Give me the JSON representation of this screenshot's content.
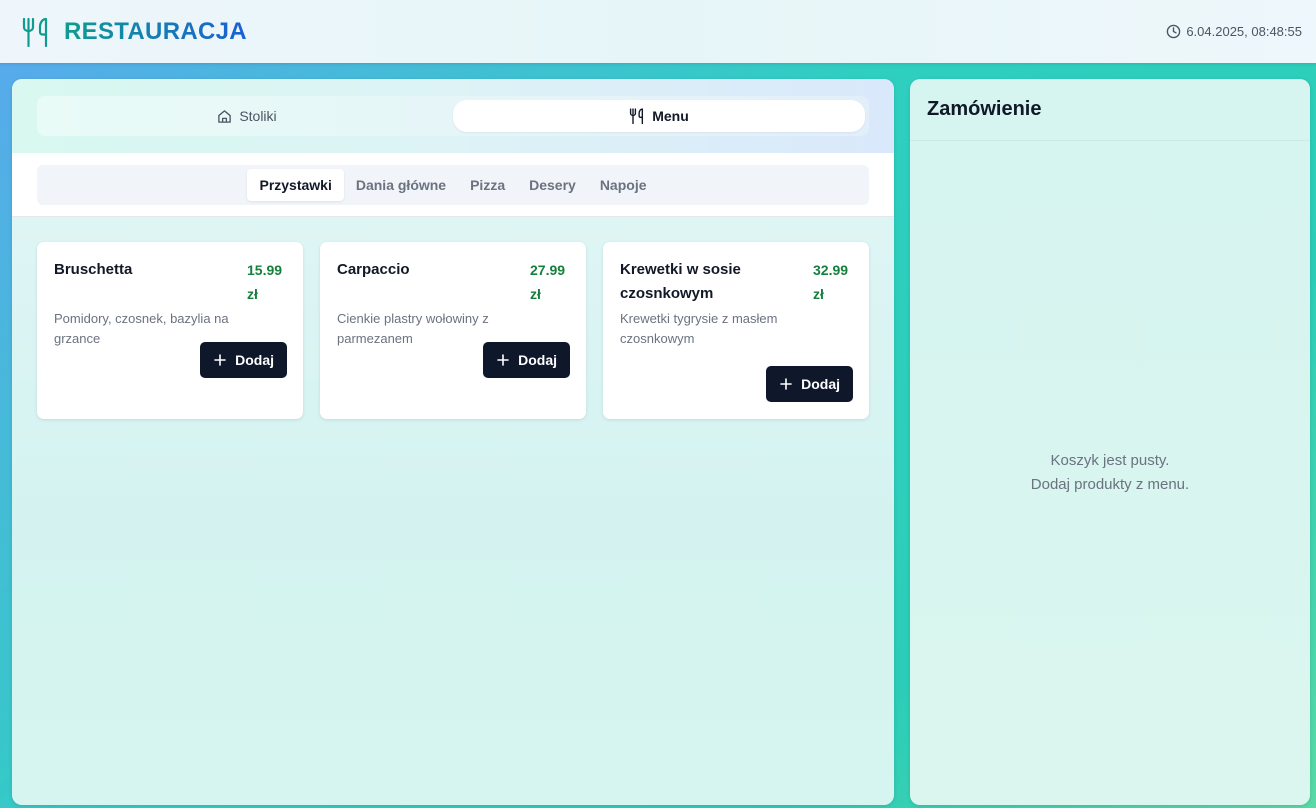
{
  "header": {
    "brand_title": "RESTAURACJA",
    "brand_icon": "utensils-icon",
    "datetime": "6.04.2025, 08:48:55",
    "clock_icon": "clock-icon"
  },
  "view_tabs": [
    {
      "label": "Stoliki",
      "icon": "home-icon",
      "active": false
    },
    {
      "label": "Menu",
      "icon": "utensils-icon",
      "active": true
    }
  ],
  "categories": [
    {
      "label": "Przystawki",
      "active": true
    },
    {
      "label": "Dania główne",
      "active": false
    },
    {
      "label": "Pizza",
      "active": false
    },
    {
      "label": "Desery",
      "active": false
    },
    {
      "label": "Napoje",
      "active": false
    }
  ],
  "menu_items": [
    {
      "name": "Bruschetta",
      "price": "15.99 zł",
      "description": "Pomidory, czosnek, bazylia na grzance",
      "button": "Dodaj"
    },
    {
      "name": "Carpaccio",
      "price": "27.99 zł",
      "description": "Cienkie plastry wołowiny z parmezanem",
      "button": "Dodaj"
    },
    {
      "name": "Krewetki w sosie czosnkowym",
      "price": "32.99 zł",
      "description": "Krewetki tygrysie z masłem czosnkowym",
      "button": "Dodaj"
    }
  ],
  "order": {
    "title": "Zamówienie",
    "empty_line1": "Koszyk jest pusty.",
    "empty_line2": "Dodaj produkty z menu."
  },
  "colors": {
    "brand_gradient_start": "#0f9c8f",
    "brand_gradient_end": "#1b5fd6",
    "price": "#15803d",
    "button_bg": "#0f172a"
  }
}
